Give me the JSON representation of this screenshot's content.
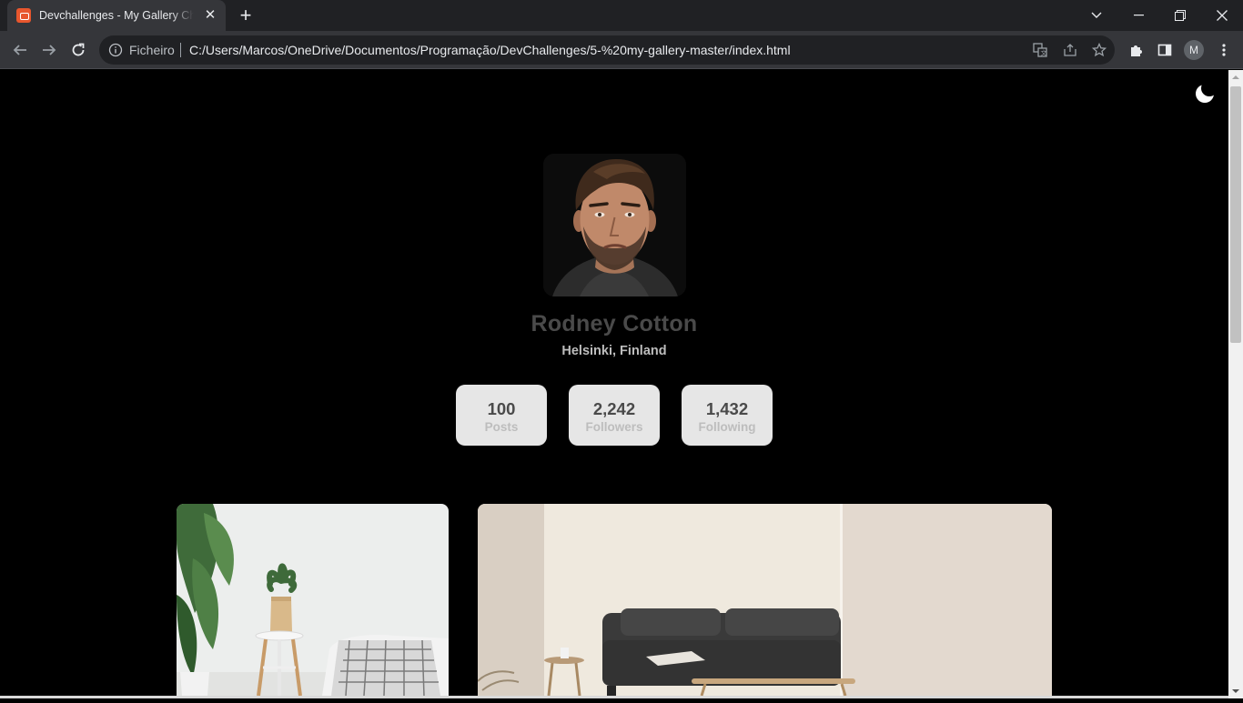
{
  "browser": {
    "tab_title": "Devchallenges - My Gallery Challenge",
    "scheme_label": "Ficheiro",
    "url": "C:/Users/Marcos/OneDrive/Documentos/Programação/DevChallenges/5-%20my-gallery-master/index.html",
    "profile_initial": "M"
  },
  "profile": {
    "name": "Rodney Cotton",
    "location": "Helsinki, Finland"
  },
  "stats": [
    {
      "value": "100",
      "label": "Posts"
    },
    {
      "value": "2,242",
      "label": "Followers"
    },
    {
      "value": "1,432",
      "label": "Following"
    }
  ],
  "colors": {
    "page_background": "#000000",
    "card_background": "#e6e6e6",
    "name_text": "#4a4a4a",
    "muted_text": "#bdbdbd"
  },
  "icons": {
    "theme_toggle": "moon-icon"
  }
}
